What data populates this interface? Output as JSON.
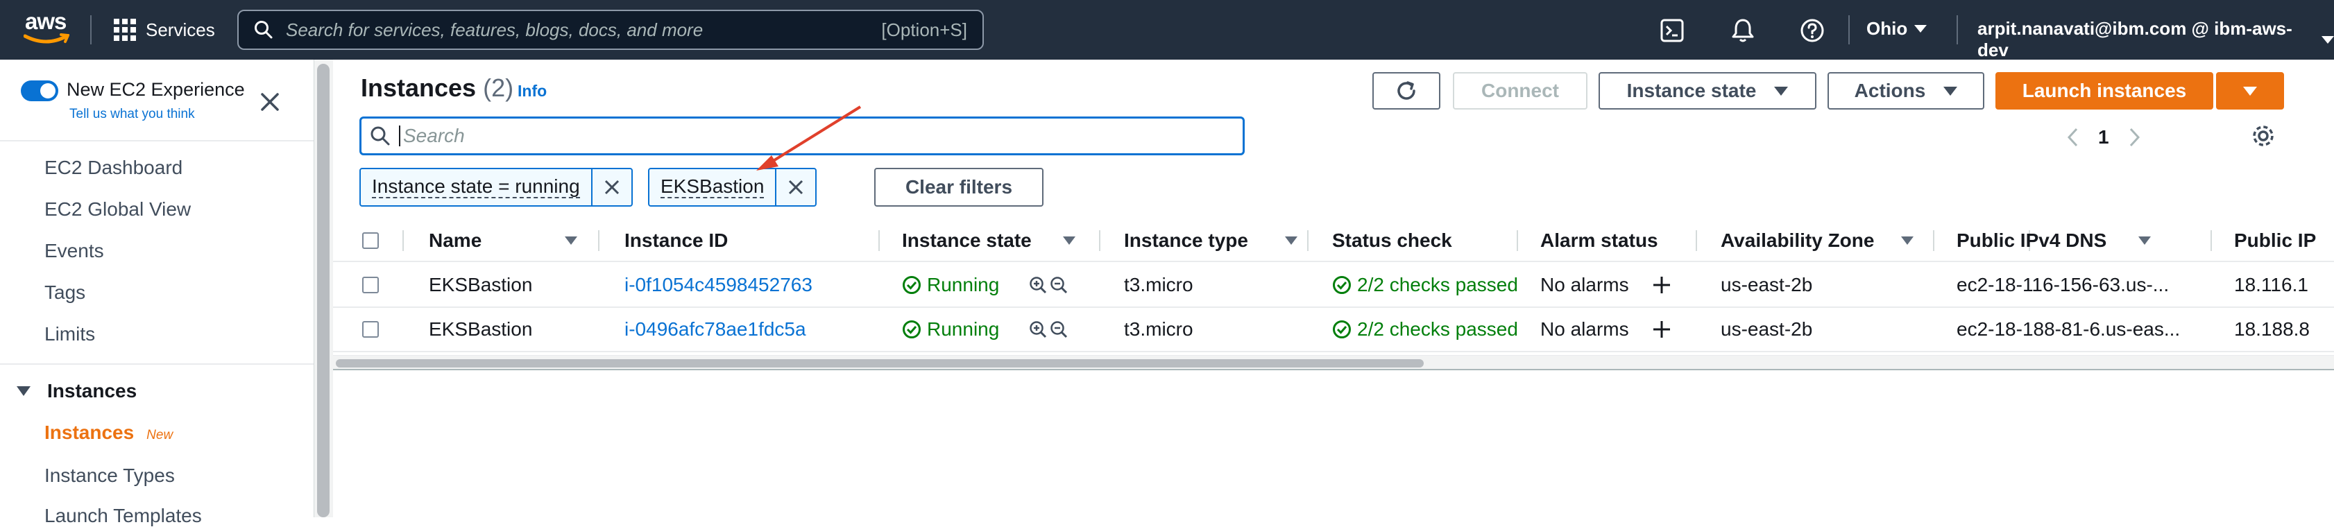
{
  "topnav": {
    "logo": "aws",
    "services_label": "Services",
    "search_placeholder": "Search for services, features, blogs, docs, and more",
    "search_shortcut": "[Option+S]",
    "region": "Ohio",
    "account": "arpit.nanavati@ibm.com @ ibm-aws-dev",
    "icons": [
      "cloudshell-icon",
      "bell-icon",
      "help-icon"
    ]
  },
  "sidebar": {
    "new_experience_label": "New EC2 Experience",
    "new_experience_enabled": true,
    "tell_us": "Tell us what you think",
    "links": [
      "EC2 Dashboard",
      "EC2 Global View",
      "Events",
      "Tags",
      "Limits"
    ],
    "section_title": "Instances",
    "active_item": "Instances",
    "active_badge": "New",
    "sub_items": [
      "Instance Types",
      "Launch Templates"
    ]
  },
  "main": {
    "title": "Instances",
    "count": "(2)",
    "info_link": "Info",
    "buttons": {
      "connect": "Connect",
      "instance_state": "Instance state",
      "actions": "Actions",
      "launch": "Launch instances"
    },
    "search_placeholder": "Search",
    "page_number": "1",
    "filters": [
      "Instance state = running",
      "EKSBastion"
    ],
    "clear_filters": "Clear filters"
  },
  "table": {
    "columns": [
      "Name",
      "Instance ID",
      "Instance state",
      "Instance type",
      "Status check",
      "Alarm status",
      "Availability Zone",
      "Public IPv4 DNS",
      "Public IP"
    ],
    "rows": [
      {
        "name": "EKSBastion",
        "instance_id": "i-0f1054c4598452763",
        "state": "Running",
        "type": "t3.micro",
        "status_check": "2/2 checks passed",
        "alarm": "No alarms",
        "az": "us-east-2b",
        "dns": "ec2-18-116-156-63.us-...",
        "public_ip": "18.116.1"
      },
      {
        "name": "EKSBastion",
        "instance_id": "i-0496afc78ae1fdc5a",
        "state": "Running",
        "type": "t3.micro",
        "status_check": "2/2 checks passed",
        "alarm": "No alarms",
        "az": "us-east-2b",
        "dns": "ec2-18-188-81-6.us-eas...",
        "public_ip": "18.188.8"
      }
    ]
  },
  "colors": {
    "nav_bg": "#232f3e",
    "accent_orange": "#ec7211",
    "link_blue": "#0972d3",
    "success_green": "#037f0c",
    "annotation_red": "#e0402b"
  }
}
